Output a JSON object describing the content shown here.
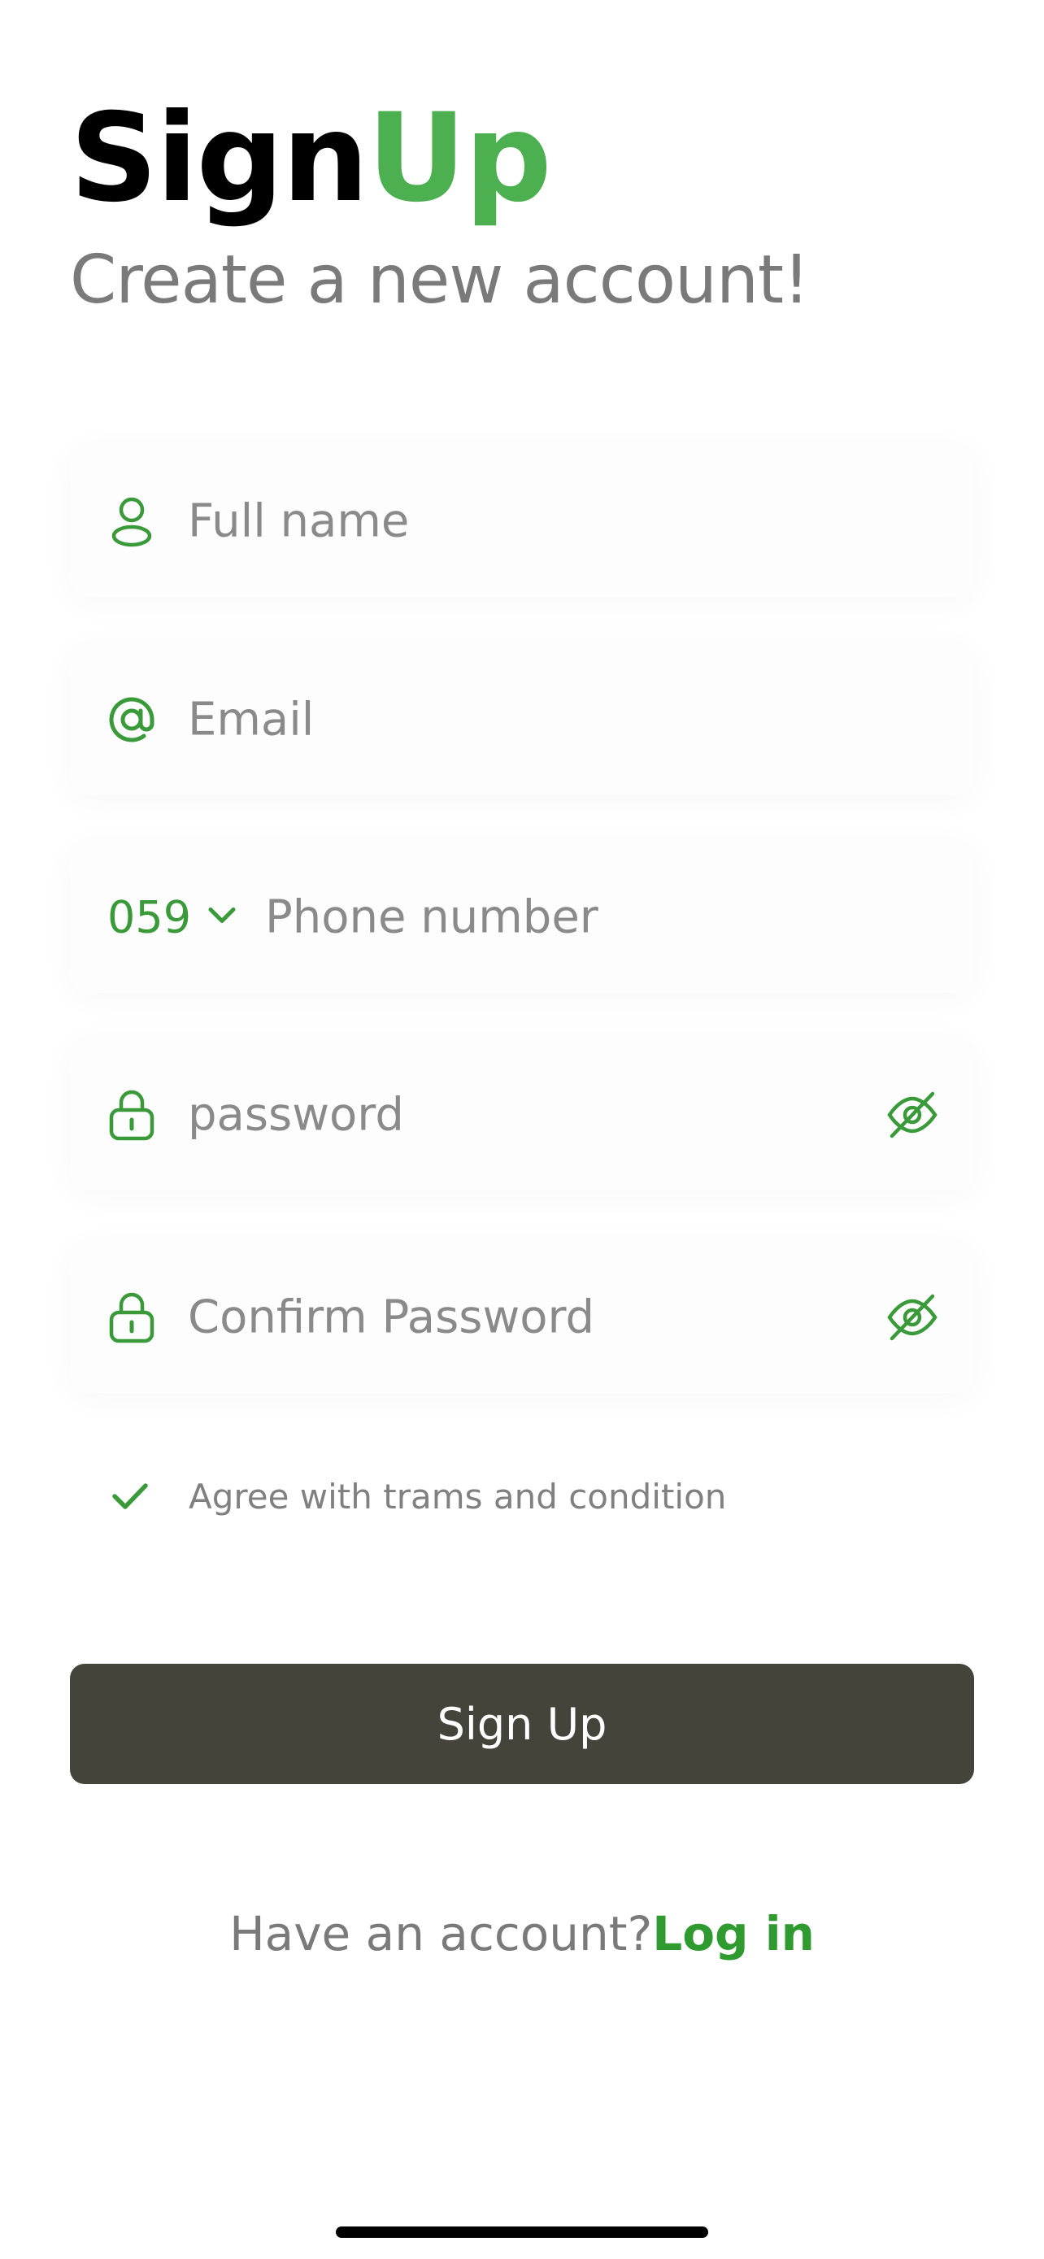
{
  "header": {
    "title_part1": "Sign",
    "title_part2": "Up",
    "subtitle": "Create a new account!"
  },
  "form": {
    "full_name": {
      "placeholder": "Full name",
      "icon": "user-icon"
    },
    "email": {
      "placeholder": "Email",
      "icon": "at-icon"
    },
    "phone": {
      "country_code": "059",
      "placeholder": "Phone number",
      "icon": "chevron-down-icon"
    },
    "password": {
      "placeholder": "password",
      "icon": "lock-icon",
      "toggle_icon": "eye-off-icon"
    },
    "confirm_password": {
      "placeholder": "Confirm Password",
      "icon": "lock-icon",
      "toggle_icon": "eye-off-icon"
    },
    "agree": {
      "label": "Agree with trams and condition",
      "checked": true
    }
  },
  "actions": {
    "signup_label": "Sign Up"
  },
  "footer": {
    "question": "Have an account?",
    "login_link": "Log in"
  },
  "colors": {
    "accent": "#4caf50",
    "icon_green": "#3a9a3a",
    "button_bg": "#45443b",
    "placeholder": "#8a8a8a"
  }
}
